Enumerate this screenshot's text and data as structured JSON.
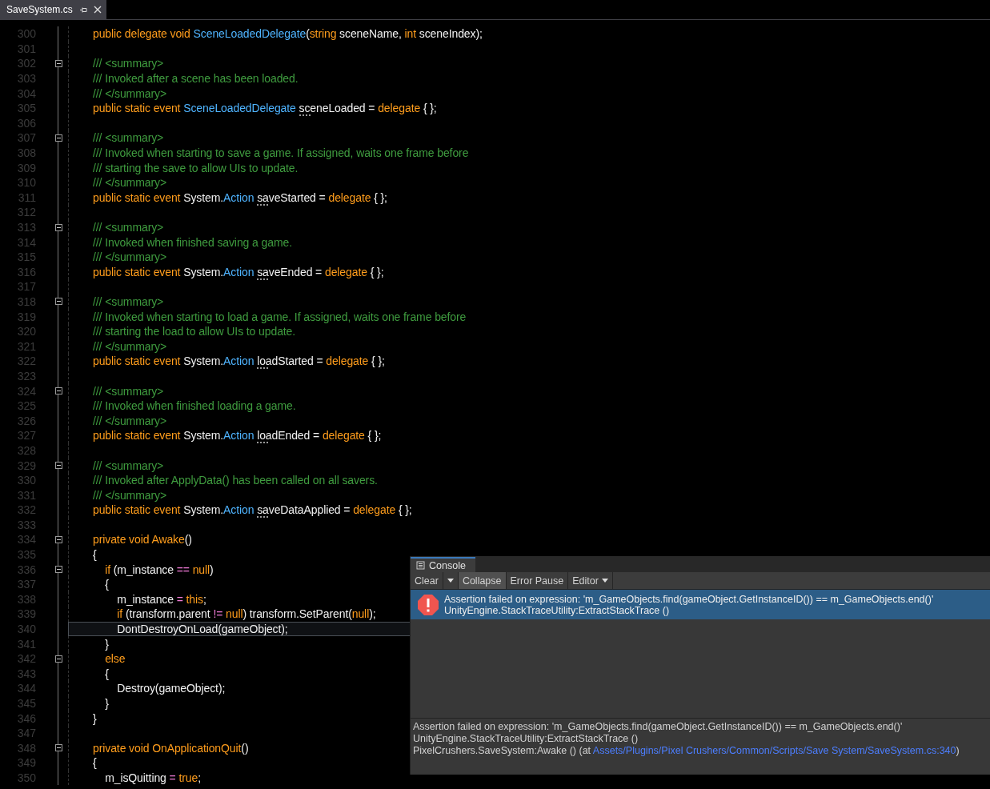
{
  "tab": {
    "title": "SaveSystem.cs",
    "selected": true
  },
  "lines": [
    {
      "n": "300",
      "fold": false,
      "current": false,
      "tokens": [
        {
          "kind": "kw",
          "t": "public delegate void "
        },
        {
          "kind": "type",
          "t": "SceneLoadedDelegate"
        },
        {
          "kind": "plain",
          "t": "("
        },
        {
          "kind": "kw",
          "t": "string"
        },
        {
          "kind": "plain",
          "t": " sceneName, "
        },
        {
          "kind": "kw",
          "t": "int"
        },
        {
          "kind": "plain",
          "t": " sceneIndex);"
        }
      ]
    },
    {
      "n": "301",
      "fold": false,
      "current": false
    },
    {
      "n": "302",
      "fold": true,
      "current": false,
      "tokens": [
        {
          "kind": "comment",
          "t": "/// <summary>"
        }
      ]
    },
    {
      "n": "303",
      "fold": false,
      "current": false,
      "tokens": [
        {
          "kind": "comment",
          "t": "/// Invoked after a scene has been loaded."
        }
      ]
    },
    {
      "n": "304",
      "fold": false,
      "current": false,
      "tokens": [
        {
          "kind": "comment",
          "t": "/// </summary>"
        }
      ]
    },
    {
      "n": "305",
      "fold": false,
      "current": false,
      "tokens": [
        {
          "kind": "kw",
          "t": "public static event "
        },
        {
          "kind": "type",
          "t": "SceneLoadedDelegate "
        },
        {
          "kind": "plain",
          "t": "sceneLoaded",
          "dots": true
        },
        {
          "kind": "plain",
          "t": " = "
        },
        {
          "kind": "kw",
          "t": "delegate"
        },
        {
          "kind": "plain",
          "t": " { };"
        }
      ]
    },
    {
      "n": "306",
      "fold": false,
      "current": false
    },
    {
      "n": "307",
      "fold": true,
      "current": false,
      "tokens": [
        {
          "kind": "comment",
          "t": "/// <summary>"
        }
      ]
    },
    {
      "n": "308",
      "fold": false,
      "current": false,
      "tokens": [
        {
          "kind": "comment",
          "t": "/// Invoked when starting to save a game. If assigned, waits one frame before"
        }
      ]
    },
    {
      "n": "309",
      "fold": false,
      "current": false,
      "tokens": [
        {
          "kind": "comment",
          "t": "/// starting the save to allow UIs to update."
        }
      ]
    },
    {
      "n": "310",
      "fold": false,
      "current": false,
      "tokens": [
        {
          "kind": "comment",
          "t": "/// </summary>"
        }
      ]
    },
    {
      "n": "311",
      "fold": false,
      "current": false,
      "tokens": [
        {
          "kind": "kw",
          "t": "public static event "
        },
        {
          "kind": "plain",
          "t": "System."
        },
        {
          "kind": "type",
          "t": "Action "
        },
        {
          "kind": "plain",
          "t": "saveStarted",
          "dots": true
        },
        {
          "kind": "plain",
          "t": " = "
        },
        {
          "kind": "kw",
          "t": "delegate"
        },
        {
          "kind": "plain",
          "t": " { };"
        }
      ]
    },
    {
      "n": "312",
      "fold": false,
      "current": false
    },
    {
      "n": "313",
      "fold": true,
      "current": false,
      "tokens": [
        {
          "kind": "comment",
          "t": "/// <summary>"
        }
      ]
    },
    {
      "n": "314",
      "fold": false,
      "current": false,
      "tokens": [
        {
          "kind": "comment",
          "t": "/// Invoked when finished saving a game."
        }
      ]
    },
    {
      "n": "315",
      "fold": false,
      "current": false,
      "tokens": [
        {
          "kind": "comment",
          "t": "/// </summary>"
        }
      ]
    },
    {
      "n": "316",
      "fold": false,
      "current": false,
      "tokens": [
        {
          "kind": "kw",
          "t": "public static event "
        },
        {
          "kind": "plain",
          "t": "System."
        },
        {
          "kind": "type",
          "t": "Action "
        },
        {
          "kind": "plain",
          "t": "saveEnded",
          "dots": true
        },
        {
          "kind": "plain",
          "t": " = "
        },
        {
          "kind": "kw",
          "t": "delegate"
        },
        {
          "kind": "plain",
          "t": " { };"
        }
      ]
    },
    {
      "n": "317",
      "fold": false,
      "current": false
    },
    {
      "n": "318",
      "fold": true,
      "current": false,
      "tokens": [
        {
          "kind": "comment",
          "t": "/// <summary>"
        }
      ]
    },
    {
      "n": "319",
      "fold": false,
      "current": false,
      "tokens": [
        {
          "kind": "comment",
          "t": "/// Invoked when starting to load a game. If assigned, waits one frame before"
        }
      ]
    },
    {
      "n": "320",
      "fold": false,
      "current": false,
      "tokens": [
        {
          "kind": "comment",
          "t": "/// starting the load to allow UIs to update."
        }
      ]
    },
    {
      "n": "321",
      "fold": false,
      "current": false,
      "tokens": [
        {
          "kind": "comment",
          "t": "/// </summary>"
        }
      ]
    },
    {
      "n": "322",
      "fold": false,
      "current": false,
      "tokens": [
        {
          "kind": "kw",
          "t": "public static event "
        },
        {
          "kind": "plain",
          "t": "System."
        },
        {
          "kind": "type",
          "t": "Action "
        },
        {
          "kind": "plain",
          "t": "loadStarted",
          "dots": true
        },
        {
          "kind": "plain",
          "t": " = "
        },
        {
          "kind": "kw",
          "t": "delegate"
        },
        {
          "kind": "plain",
          "t": " { };"
        }
      ]
    },
    {
      "n": "323",
      "fold": false,
      "current": false
    },
    {
      "n": "324",
      "fold": true,
      "current": false,
      "tokens": [
        {
          "kind": "comment",
          "t": "/// <summary>"
        }
      ]
    },
    {
      "n": "325",
      "fold": false,
      "current": false,
      "tokens": [
        {
          "kind": "comment",
          "t": "/// Invoked when finished loading a game."
        }
      ]
    },
    {
      "n": "326",
      "fold": false,
      "current": false,
      "tokens": [
        {
          "kind": "comment",
          "t": "/// </summary>"
        }
      ]
    },
    {
      "n": "327",
      "fold": false,
      "current": false,
      "tokens": [
        {
          "kind": "kw",
          "t": "public static event "
        },
        {
          "kind": "plain",
          "t": "System."
        },
        {
          "kind": "type",
          "t": "Action "
        },
        {
          "kind": "plain",
          "t": "loadEnded",
          "dots": true
        },
        {
          "kind": "plain",
          "t": " = "
        },
        {
          "kind": "kw",
          "t": "delegate"
        },
        {
          "kind": "plain",
          "t": " { };"
        }
      ]
    },
    {
      "n": "328",
      "fold": false,
      "current": false
    },
    {
      "n": "329",
      "fold": true,
      "current": false,
      "tokens": [
        {
          "kind": "comment",
          "t": "/// <summary>"
        }
      ]
    },
    {
      "n": "330",
      "fold": false,
      "current": false,
      "tokens": [
        {
          "kind": "comment",
          "t": "/// Invoked after ApplyData() has been called on all savers."
        }
      ]
    },
    {
      "n": "331",
      "fold": false,
      "current": false,
      "tokens": [
        {
          "kind": "comment",
          "t": "/// </summary>"
        }
      ]
    },
    {
      "n": "332",
      "fold": false,
      "current": false,
      "tokens": [
        {
          "kind": "kw",
          "t": "public static event "
        },
        {
          "kind": "plain",
          "t": "System."
        },
        {
          "kind": "type",
          "t": "Action "
        },
        {
          "kind": "plain",
          "t": "saveDataApplied",
          "dots": true
        },
        {
          "kind": "plain",
          "t": " = "
        },
        {
          "kind": "kw",
          "t": "delegate"
        },
        {
          "kind": "plain",
          "t": " { };"
        }
      ]
    },
    {
      "n": "333",
      "fold": false,
      "current": false
    },
    {
      "n": "334",
      "fold": true,
      "current": false,
      "tokens": [
        {
          "kind": "kw",
          "t": "private void Awake"
        },
        {
          "kind": "plain",
          "t": "()"
        }
      ]
    },
    {
      "n": "335",
      "fold": false,
      "current": false,
      "tokens": [
        {
          "kind": "plain",
          "t": "{"
        }
      ]
    },
    {
      "n": "336",
      "fold": true,
      "current": false,
      "tokens": [
        {
          "kind": "kw",
          "t": "    if"
        },
        {
          "kind": "plain",
          "t": " (m_instance "
        },
        {
          "kind": "op",
          "t": "=="
        },
        {
          "kind": "kw",
          "t": " null"
        },
        {
          "kind": "plain",
          "t": ")"
        }
      ]
    },
    {
      "n": "337",
      "fold": false,
      "current": false,
      "tokens": [
        {
          "kind": "plain",
          "t": "    {"
        }
      ]
    },
    {
      "n": "338",
      "fold": false,
      "current": false,
      "tokens": [
        {
          "kind": "plain",
          "t": "        m_instance "
        },
        {
          "kind": "op",
          "t": "="
        },
        {
          "kind": "kw",
          "t": " this"
        },
        {
          "kind": "plain",
          "t": ";"
        }
      ]
    },
    {
      "n": "339",
      "fold": false,
      "current": false,
      "tokens": [
        {
          "kind": "kw",
          "t": "        if"
        },
        {
          "kind": "plain",
          "t": " (transform.parent "
        },
        {
          "kind": "op",
          "t": "!="
        },
        {
          "kind": "kw",
          "t": " null"
        },
        {
          "kind": "plain",
          "t": ") transform.SetParent("
        },
        {
          "kind": "kw",
          "t": "null"
        },
        {
          "kind": "plain",
          "t": ");"
        }
      ]
    },
    {
      "n": "340",
      "fold": false,
      "current": true,
      "tokens": [
        {
          "kind": "plain",
          "t": "        DontDestroyOnLoad(gameObject);"
        }
      ]
    },
    {
      "n": "341",
      "fold": false,
      "current": false,
      "tokens": [
        {
          "kind": "plain",
          "t": "    }"
        }
      ]
    },
    {
      "n": "342",
      "fold": true,
      "current": false,
      "tokens": [
        {
          "kind": "kw",
          "t": "    else"
        }
      ]
    },
    {
      "n": "343",
      "fold": false,
      "current": false,
      "tokens": [
        {
          "kind": "plain",
          "t": "    {"
        }
      ]
    },
    {
      "n": "344",
      "fold": false,
      "current": false,
      "tokens": [
        {
          "kind": "plain",
          "t": "        Destroy(gameObject);"
        }
      ]
    },
    {
      "n": "345",
      "fold": false,
      "current": false,
      "tokens": [
        {
          "kind": "plain",
          "t": "    }"
        }
      ]
    },
    {
      "n": "346",
      "fold": false,
      "current": false,
      "tokens": [
        {
          "kind": "plain",
          "t": "}"
        }
      ]
    },
    {
      "n": "347",
      "fold": false,
      "current": false
    },
    {
      "n": "348",
      "fold": true,
      "current": false,
      "tokens": [
        {
          "kind": "kw",
          "t": "private void OnApplicationQuit"
        },
        {
          "kind": "plain",
          "t": "()"
        }
      ]
    },
    {
      "n": "349",
      "fold": false,
      "current": false,
      "tokens": [
        {
          "kind": "plain",
          "t": "{"
        }
      ]
    },
    {
      "n": "350",
      "fold": false,
      "current": false,
      "tokens": [
        {
          "kind": "plain",
          "t": "    m_isQuitting "
        },
        {
          "kind": "op",
          "t": "="
        },
        {
          "kind": "kw",
          "t": " true"
        },
        {
          "kind": "plain",
          "t": ";"
        }
      ]
    }
  ],
  "console": {
    "tab": {
      "title": "Console",
      "selected": true
    },
    "toolbar": [
      {
        "kind": "button",
        "label": "Clear",
        "selected": false
      },
      {
        "kind": "dropdown",
        "selected": false
      },
      {
        "kind": "button",
        "label": "Collapse",
        "selected": true
      },
      {
        "kind": "button",
        "label": "Error Pause",
        "selected": false
      },
      {
        "kind": "dropdown",
        "label": "Editor",
        "selected": false
      }
    ],
    "messages": [
      {
        "kind": "error",
        "selected": true,
        "lines": [
          "Assertion failed on expression: 'm_GameObjects.find(gameObject.GetInstanceID()) == m_GameObjects.end()'",
          "UnityEngine.StackTraceUtility:ExtractStackTrace ()"
        ]
      }
    ],
    "detail": {
      "lines": [
        "Assertion failed on expression: 'm_GameObjects.find(gameObject.GetInstanceID()) == m_GameObjects.end()'",
        "UnityEngine.StackTraceUtility:ExtractStackTrace ()"
      ],
      "trace": {
        "text": "PixelCrushers.SaveSystem:Awake () (at ",
        "link": "Assets/Plugins/Pixel Crushers/Common/Scripts/Save System/SaveSystem.cs:340",
        "after": ")"
      }
    }
  }
}
